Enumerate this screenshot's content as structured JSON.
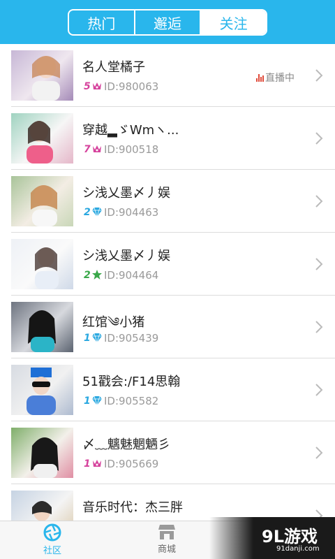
{
  "header": {
    "tabs": [
      {
        "label": "热门",
        "active": false
      },
      {
        "label": "邂逅",
        "active": false
      },
      {
        "label": "关注",
        "active": true
      }
    ]
  },
  "colors": {
    "accent": "#29b6ec",
    "live_red": "#e04a3a",
    "crown_pink": "#d6439d",
    "diamond_blue": "#2aa8e0",
    "star_green": "#3aa84a"
  },
  "list": {
    "items": [
      {
        "name": "名人堂橘子",
        "level": "5",
        "level_icon": "crown-icon",
        "id": "ID:980063",
        "status": "直播中"
      },
      {
        "name": "穿越▂ゞWmヽ...",
        "level": "7",
        "level_icon": "crown-icon",
        "id": "ID:900518"
      },
      {
        "name": "シ浅乂墨〆丿娱",
        "level": "2",
        "level_icon": "diamond-icon",
        "id": "ID:904463"
      },
      {
        "name": "シ浅乂墨〆丿娱",
        "level": "2",
        "level_icon": "star-icon",
        "id": "ID:904464"
      },
      {
        "name": "红馆༄小猪",
        "level": "1",
        "level_icon": "diamond-icon",
        "id": "ID:905439"
      },
      {
        "name": "51戳会:/F14思翰",
        "level": "1",
        "level_icon": "diamond-icon",
        "id": "ID:905582"
      },
      {
        "name": "〆﹏魑魅魍魉彡",
        "level": "1",
        "level_icon": "crown-icon",
        "id": "ID:905669"
      },
      {
        "name": "音乐时代：杰三胖",
        "level": "",
        "level_icon": "",
        "id": ""
      }
    ]
  },
  "bottom_nav": {
    "tabs": [
      {
        "label": "社区",
        "icon": "aperture-icon",
        "active": true
      },
      {
        "label": "商城",
        "icon": "store-icon",
        "active": false
      }
    ]
  },
  "watermark": {
    "logo": "9L游戏",
    "url": "91danji.com"
  }
}
